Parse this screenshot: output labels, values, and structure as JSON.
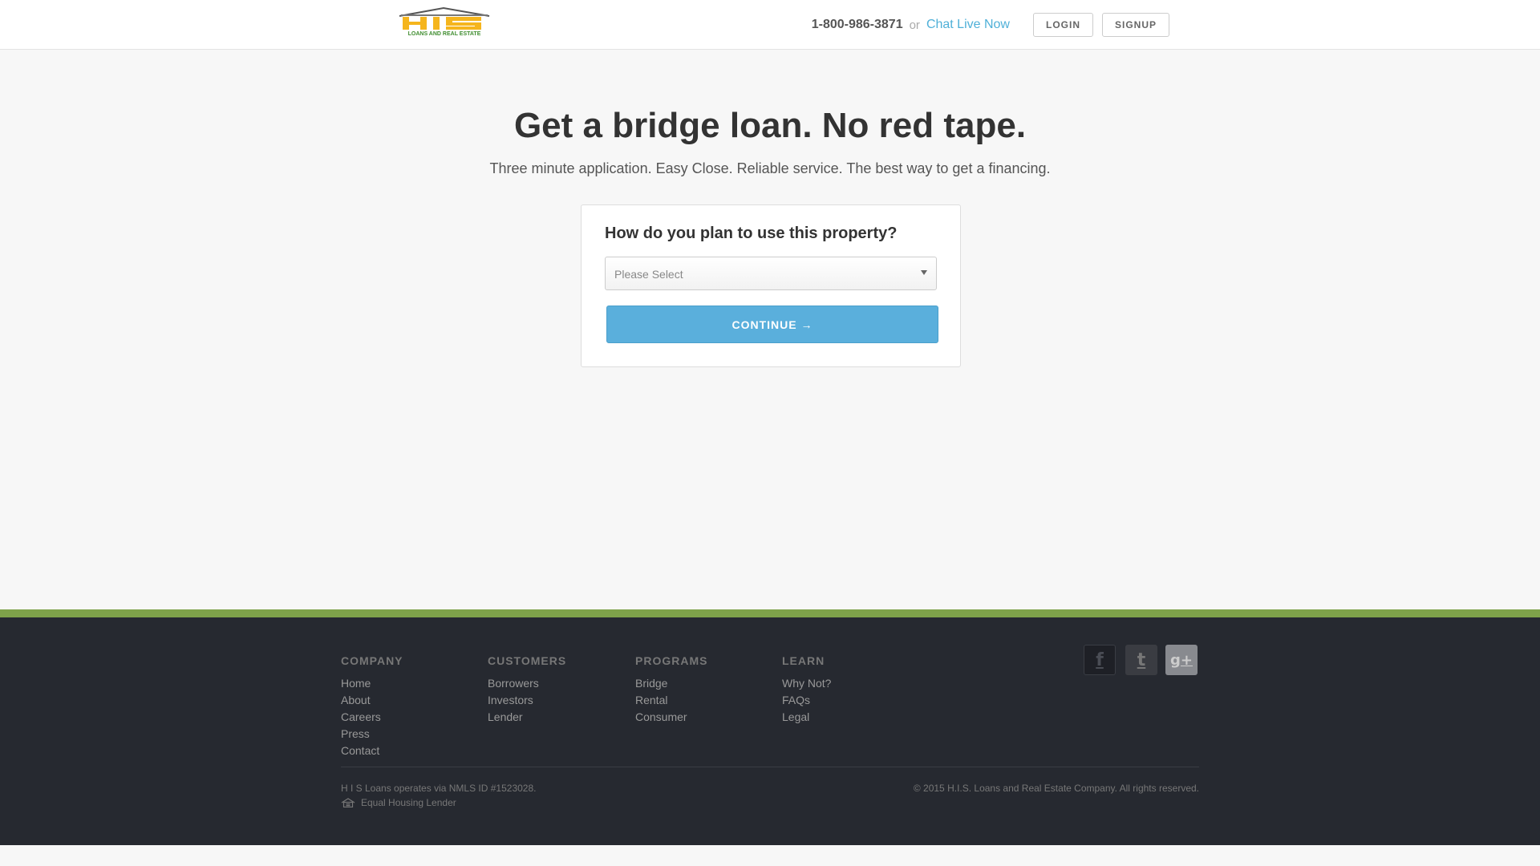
{
  "header": {
    "logo_text": "HIS",
    "logo_subtext": "LOANS AND REAL ESTATE",
    "phone": "1-800-986-3871",
    "or_text": "or",
    "chat_label": "Chat Live Now",
    "login_label": "LOGIN",
    "signup_label": "SIGNUP"
  },
  "hero": {
    "title": "Get a bridge loan. No red tape.",
    "subtitle": "Three minute application. Easy Close. Reliable service. The best way to get a financing."
  },
  "form": {
    "question": "How do you plan to use this property?",
    "select_value": "Please Select",
    "continue_label": "CONTINUE →"
  },
  "footer": {
    "columns": [
      {
        "heading": "COMPANY",
        "links": [
          "Home",
          "About",
          "Careers",
          "Press",
          "Contact"
        ]
      },
      {
        "heading": "CUSTOMERS",
        "links": [
          "Borrowers",
          "Investors",
          "Lender"
        ]
      },
      {
        "heading": "PROGRAMS",
        "links": [
          "Bridge",
          "Rental",
          "Consumer"
        ]
      },
      {
        "heading": "LEARN",
        "links": [
          "Why Not?",
          "FAQs",
          "Legal"
        ]
      }
    ],
    "social": {
      "facebook_glyph": "f",
      "twitter_glyph": "t",
      "google_glyph": "g+"
    },
    "nmls_note": "H I S Loans operates via NMLS ID #1523028.",
    "equal_housing": "Equal Housing Lender",
    "copyright": "© 2015 H.I.S. Loans and Real Estate Company. All rights reserved."
  },
  "colors": {
    "accent_blue": "#5aafdc",
    "link_blue": "#4fb0d8",
    "footer_bg": "#262930",
    "footer_stripe": "#7ea24a",
    "logo_yellow": "#f5b51d",
    "logo_green": "#3f8d2f"
  }
}
